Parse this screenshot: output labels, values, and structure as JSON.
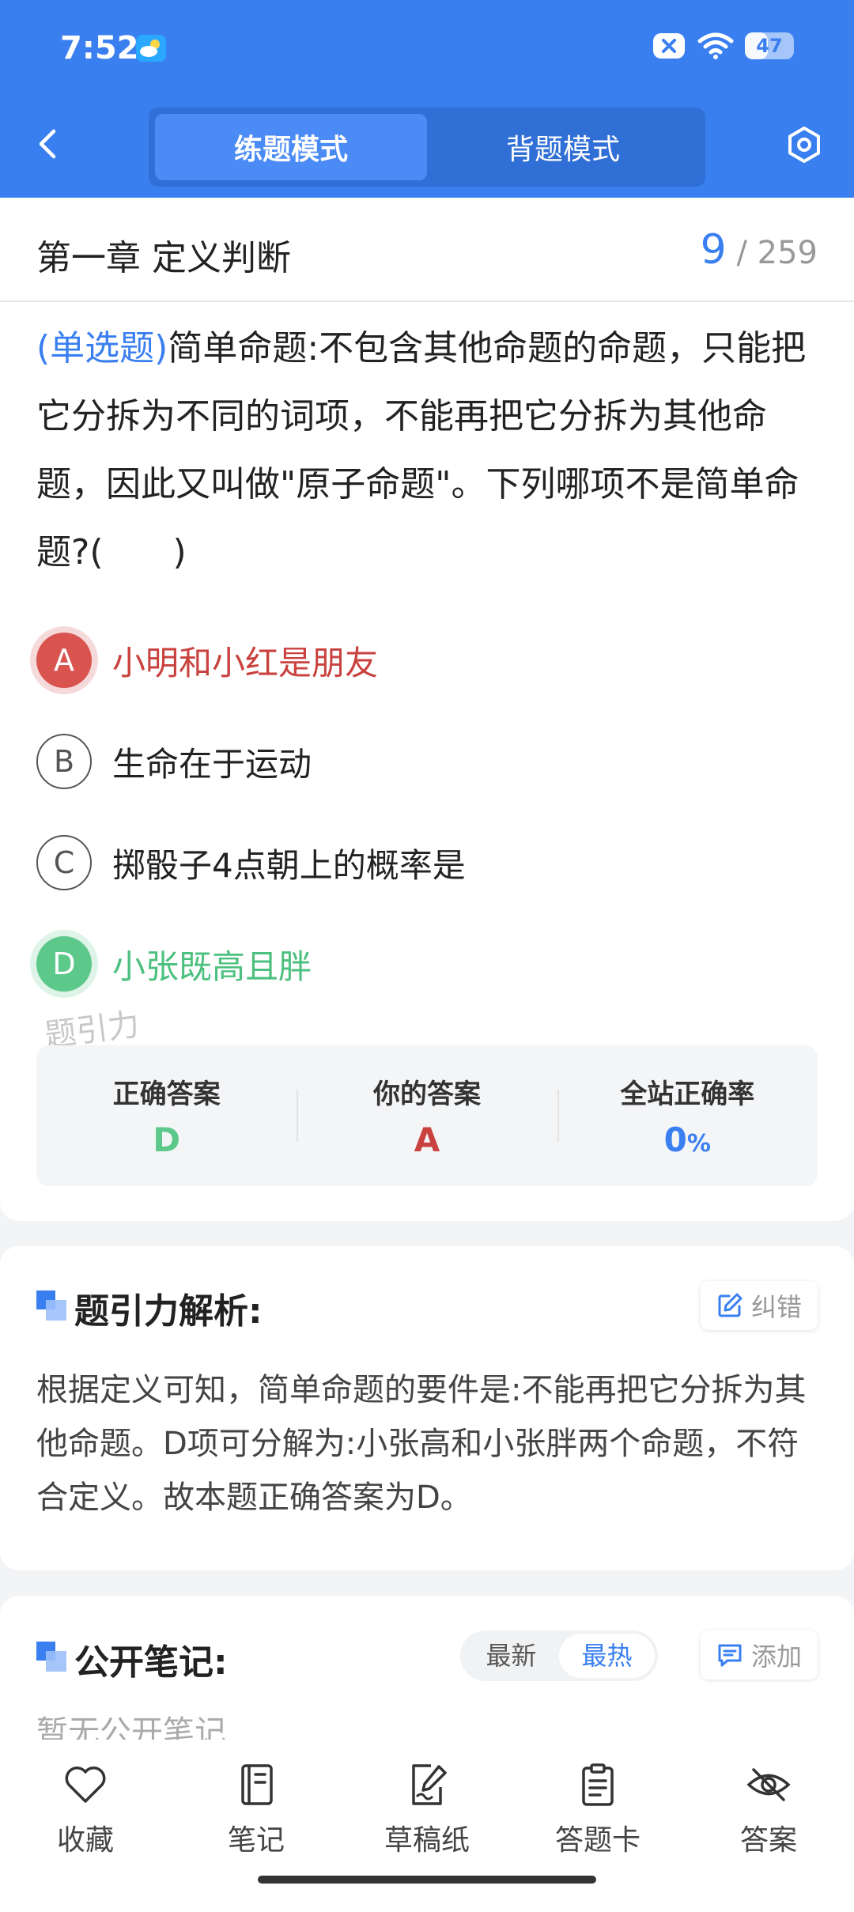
{
  "status_bar": {
    "time": "7:52",
    "battery": "47",
    "battery_level": 0.47
  },
  "header": {
    "tabs": [
      {
        "label": "练题模式",
        "active": true
      },
      {
        "label": "背题模式",
        "active": false
      }
    ]
  },
  "chapter": {
    "title": "第一章 定义判断",
    "current": "9",
    "total": "/ 259"
  },
  "question": {
    "type": "(单选题)",
    "text": "简单命题:不包含其他命题的命题，只能把它分拆为不同的词项，不能再把它分拆为其他命题，因此又叫做\"原子命题\"。下列哪项不是简单命题?(　　)"
  },
  "options": [
    {
      "letter": "A",
      "text": "小明和小红是朋友",
      "state": "wrong"
    },
    {
      "letter": "B",
      "text": "生命在于运动",
      "state": "normal"
    },
    {
      "letter": "C",
      "text": "掷骰子4点朝上的概率是",
      "state": "normal"
    },
    {
      "letter": "D",
      "text": "小张既高且胖",
      "state": "right"
    }
  ],
  "watermark": "题引力",
  "stats": {
    "correct_label": "正确答案",
    "correct_value": "D",
    "yours_label": "你的答案",
    "yours_value": "A",
    "rate_label": "全站正确率",
    "rate_value": "0",
    "rate_unit": "%"
  },
  "analysis": {
    "title": "题引力解析:",
    "report_label": "纠错",
    "text": "根据定义可知，简单命题的要件是:不能再把它分拆为其他命题。D项可分解为:小张高和小张胖两个命题，不符合定义。故本题正确答案为D。"
  },
  "notes": {
    "title": "公开笔记:",
    "sort_latest": "最新",
    "sort_hot": "最热",
    "add_label": "添加",
    "empty": "暂无公开笔记"
  },
  "bottom_nav": [
    {
      "label": "收藏",
      "icon": "heart-icon"
    },
    {
      "label": "笔记",
      "icon": "notebook-icon"
    },
    {
      "label": "草稿纸",
      "icon": "draft-icon"
    },
    {
      "label": "答题卡",
      "icon": "clipboard-icon"
    },
    {
      "label": "答案",
      "icon": "eye-off-icon"
    }
  ],
  "colors": {
    "primary": "#3a7ff0",
    "wrong": "#d9534f",
    "right": "#5cc98a"
  }
}
